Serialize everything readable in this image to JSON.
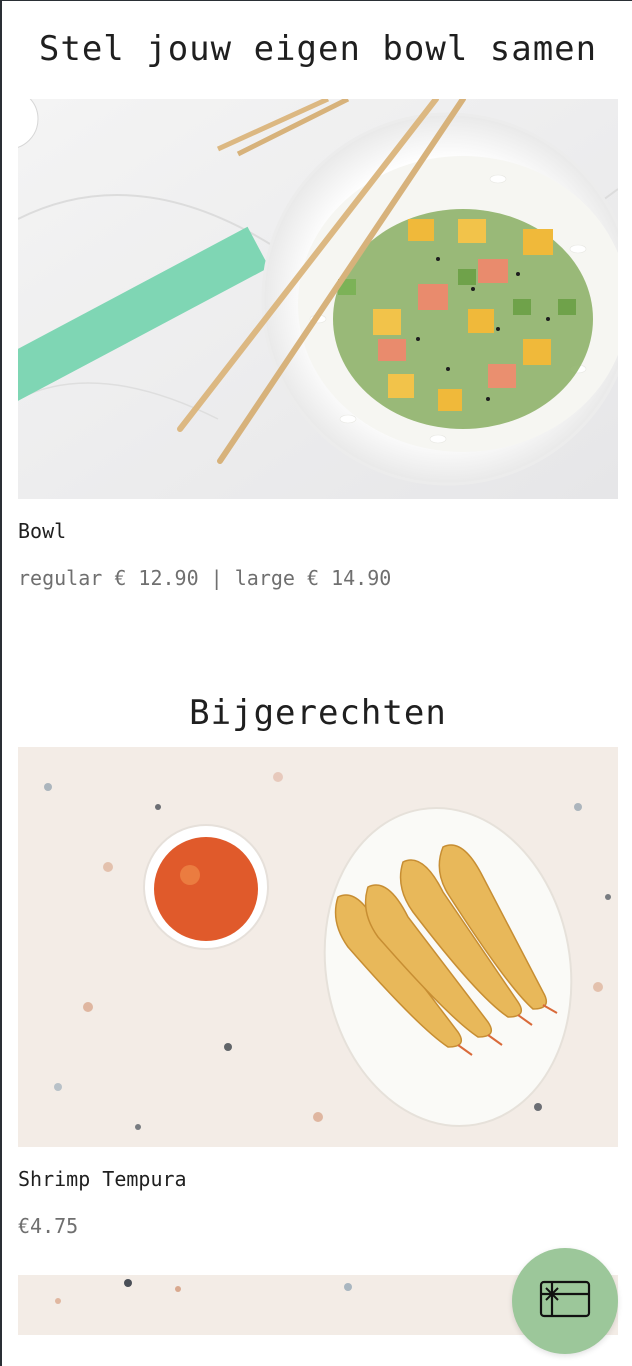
{
  "sections": [
    {
      "title": "Stel jouw eigen bowl samen",
      "items": [
        {
          "image": "poke-bowl-photo",
          "name": "Bowl",
          "price": "regular € 12.90 | large € 14.90"
        }
      ]
    },
    {
      "title": "Bijgerechten",
      "items": [
        {
          "image": "shrimp-tempura-photo",
          "name": "Shrimp Tempura",
          "price": "€4.75"
        }
      ]
    }
  ],
  "fab": {
    "icon": "gift-card-icon",
    "color": "#9cc79a"
  },
  "colors": {
    "title": "#1f1f1f",
    "price": "#6f6f6f",
    "chopstick_sleeve": "#7fd6b4",
    "terrazzo_bg": "#f3ece6"
  }
}
